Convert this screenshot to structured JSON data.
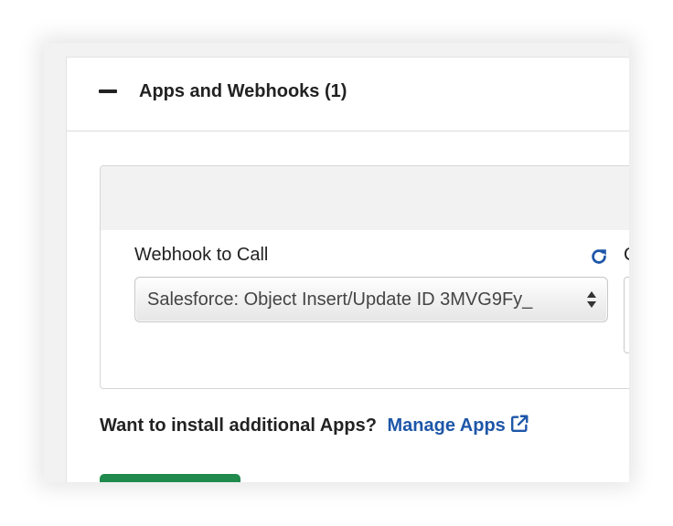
{
  "section": {
    "title": "Apps and Webhooks (1)",
    "collapse_icon": "minus-icon"
  },
  "webhook": {
    "label": "Webhook to Call",
    "selected_value": "Salesforce: Object Insert/Update ID 3MVG9Fy_",
    "refresh_icon": "refresh-icon",
    "next_column_label": "C"
  },
  "install": {
    "prompt": "Want to install additional Apps?",
    "link_text": "Manage Apps",
    "link_icon": "external-link-icon"
  },
  "colors": {
    "link": "#1e56a8",
    "primary_button": "#1f8a4c",
    "refresh_icon": "#1e56a8"
  }
}
